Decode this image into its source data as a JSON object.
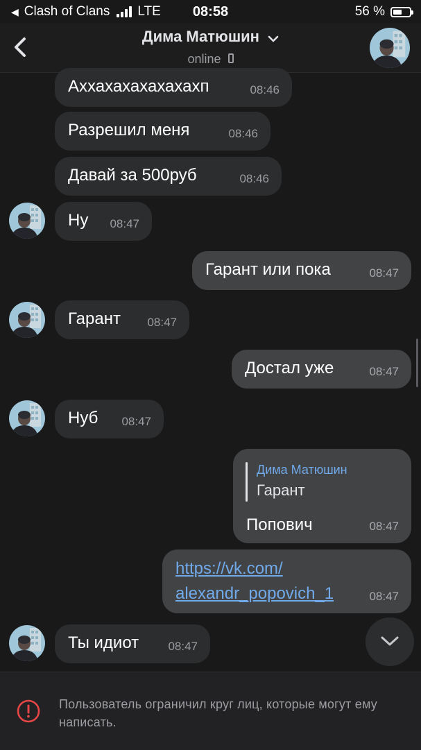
{
  "status_bar": {
    "back_app": "Clash of Clans",
    "network": "LTE",
    "time": "08:58",
    "battery_percent": "56 %",
    "battery_level": 0.56
  },
  "header": {
    "contact_name": "Дима Матюшин",
    "status": "online"
  },
  "messages": [
    {
      "direction": "in",
      "text": "Аххахахахахахахп",
      "time": "08:46"
    },
    {
      "direction": "in",
      "text": "Разрешил меня",
      "time": "08:46"
    },
    {
      "direction": "in",
      "text": "Давай за 500руб",
      "time": "08:46"
    },
    {
      "direction": "in",
      "text": "Ну",
      "time": "08:47"
    },
    {
      "direction": "out",
      "text": "Гарант или пока",
      "time": "08:47"
    },
    {
      "direction": "in",
      "text": "Гарант",
      "time": "08:47"
    },
    {
      "direction": "out",
      "text": "Достал уже",
      "time": "08:47"
    },
    {
      "direction": "in",
      "text": "Нуб",
      "time": "08:47"
    },
    {
      "direction": "out",
      "reply_to_author": "Дима Матюшин",
      "reply_to_text": "Гарант",
      "text": "Попович",
      "time": "08:47"
    },
    {
      "direction": "out",
      "link_line1": "https://vk.com/",
      "link_line2": "alexandr_popovich_1",
      "time": "08:47"
    },
    {
      "direction": "in",
      "text": "Ты идиот",
      "time": "08:47"
    }
  ],
  "footer": {
    "notice": "Пользователь ограничил круг лиц, которые могут ему написать."
  },
  "icons": {
    "back": "chevron-left-icon",
    "title_dropdown": "chevron-down-icon",
    "device": "phone-icon",
    "scroll": "chevron-down-icon",
    "warning": "exclamation-circle-icon"
  },
  "colors": {
    "background": "#19191a",
    "incoming_bubble": "#2c2d2e",
    "outgoing_bubble": "#424345",
    "link": "#71aaeb",
    "warning": "#e64646"
  }
}
